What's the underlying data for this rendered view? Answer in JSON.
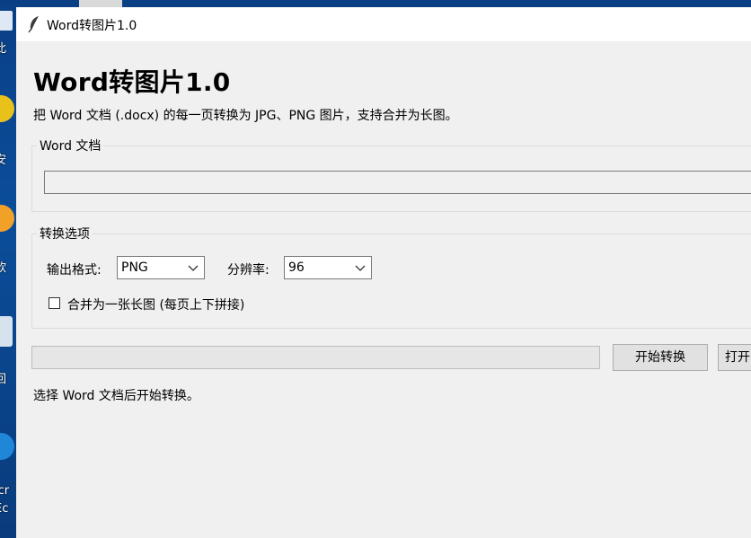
{
  "desktop": {
    "labels": [
      "此",
      "安",
      "软",
      "回",
      "icr",
      "Ec"
    ]
  },
  "window": {
    "title": "Word转图片1.0",
    "app_icon": "feather-icon"
  },
  "header": {
    "title": "Word转图片1.0",
    "subtitle": "把 Word 文档 (.docx) 的每一页转换为 JPG、PNG 图片，支持合并为长图。"
  },
  "word_group": {
    "label": "Word 文档",
    "path_value": ""
  },
  "options_group": {
    "label": "转换选项",
    "format_label": "输出格式:",
    "format_value": "PNG",
    "dpi_label": "分辨率:",
    "dpi_value": "96",
    "merge_label": "合并为一张长图 (每页上下拼接)",
    "merge_checked": false
  },
  "actions": {
    "progress": 0,
    "start_label": "开始转换",
    "open_label": "打开"
  },
  "status": "选择 Word 文档后开始转换。",
  "colors": {
    "window_bg": "#f0f0f0",
    "desktop_bg": "#0b3a7a"
  }
}
